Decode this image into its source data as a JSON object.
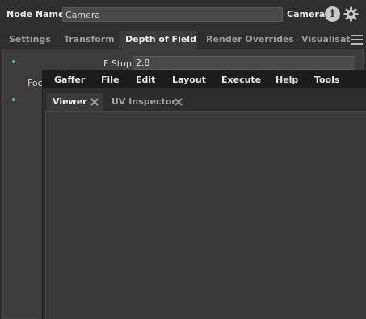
{
  "node_editor": {
    "node_name_label": "Node Name",
    "node_name_value": "Camera",
    "node_type": "Camera",
    "tabs": [
      {
        "label": "Settings"
      },
      {
        "label": "Transform"
      },
      {
        "label": "Depth of Field",
        "active": true
      },
      {
        "label": "Render Overrides"
      },
      {
        "label": "Visualisatio"
      }
    ],
    "fstop_label": "F Stop",
    "fstop_value": "2.8",
    "focus_label": "Foc",
    "accent_color": "#5dbb7d"
  },
  "window": {
    "menu": [
      "Gaffer",
      "File",
      "Edit",
      "Layout",
      "Execute",
      "Help",
      "Tools"
    ],
    "tabs": [
      {
        "label": "Viewer",
        "active": true
      },
      {
        "label": "UV Inspector",
        "active": false
      }
    ]
  },
  "icons": {
    "info": "info-icon",
    "settings": "gear-icon",
    "tab_menu": "hamburger-menu-icon",
    "close": "close-icon"
  }
}
